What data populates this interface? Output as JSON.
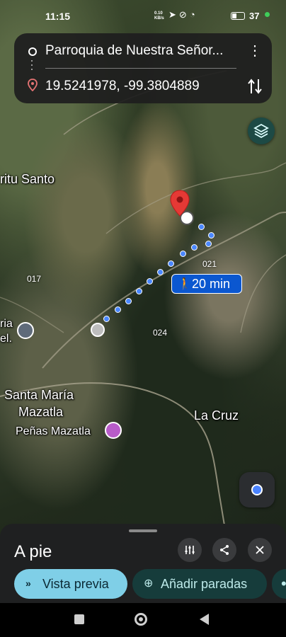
{
  "status_bar": {
    "time": "11:15",
    "net_speed": "0.10\nKB/s",
    "battery_level": "37"
  },
  "route": {
    "origin": "Parroquia de Nuestra Señor...",
    "destination": "19.5241978, -99.3804889"
  },
  "map": {
    "labels": {
      "place_espiritu": "ritu Santo",
      "place_santa_maria_1": "Santa María",
      "place_santa_maria_2": "Mazatla",
      "place_penas": "Peñas Mazatla",
      "place_la_cruz": "La Cruz",
      "place_edge_1": "ria",
      "place_edge_2": "el.",
      "road_017": "017",
      "road_021": "021",
      "road_024": "024"
    },
    "walk_time": "20 min"
  },
  "sheet": {
    "title": "A pie",
    "preview_label": "Vista previa",
    "add_stops_label": "Añadir paradas"
  },
  "colors": {
    "accent_blue": "#0b57d0",
    "route_dot": "#4a87ff",
    "pin_red": "#e53935",
    "preview_chip": "#7fcfe7"
  }
}
